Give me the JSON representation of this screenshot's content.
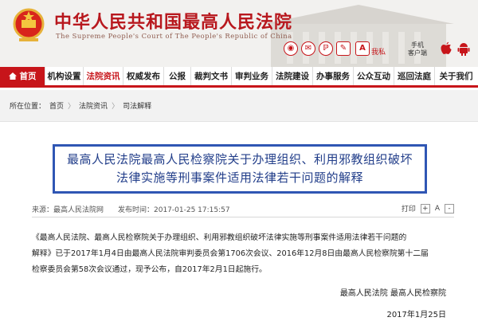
{
  "header": {
    "title": "中华人民共和国最高人民法院",
    "subtitle": "The Supreme People's Court of The People's Republic of China",
    "zoom_label": "我私",
    "mobile_label_line1": "手机",
    "mobile_label_line2": "客户端",
    "accent_color": "#c7151a",
    "social_icons": [
      "weibo-icon",
      "wechat-icon",
      "pinterest-like-icon",
      "news-icon",
      "font-size-icon"
    ]
  },
  "nav": {
    "items": [
      {
        "label": "首页",
        "icon": "home-icon"
      },
      {
        "label": "机构设置"
      },
      {
        "label": "法院资讯"
      },
      {
        "label": "权威发布"
      },
      {
        "label": "公报"
      },
      {
        "label": "裁判文书"
      },
      {
        "label": "审判业务"
      },
      {
        "label": "法院建设"
      },
      {
        "label": "办事服务"
      },
      {
        "label": "公众互动"
      },
      {
        "label": "巡回法庭"
      },
      {
        "label": "关于我们"
      }
    ]
  },
  "breadcrumb": {
    "prefix": "所在位置：",
    "items": [
      "首页",
      "法院资讯",
      "司法解释"
    ],
    "separator": "〉"
  },
  "article": {
    "title_line1": "最高人民法院最高人民检察院关于办理组织、利用邪教组织破坏",
    "title_line2": "法律实施等刑事案件适用法律若干问题的解释",
    "source": "来源：最高人民法院网",
    "date": "发布时间：2017-01-25 17:15:57",
    "tools": [
      "打印",
      "+",
      "A",
      "-"
    ],
    "body_line1": "《最高人民法院、最高人民检察院关于办理组织、利用邪教组织破坏法律实施等刑事案件适用法律若干问题的",
    "body_line2": "解释》已于2017年1月4日由最高人民法院审判委员会第1706次会议、2016年12月8日由最高人民检察院第十二届",
    "body_line3": "检察委员会第58次会议通过，现予公布，自2017年2月1日起施行。",
    "signature": "最高人民法院 最高人民检察院",
    "sign_date": "2017年1月25日"
  }
}
